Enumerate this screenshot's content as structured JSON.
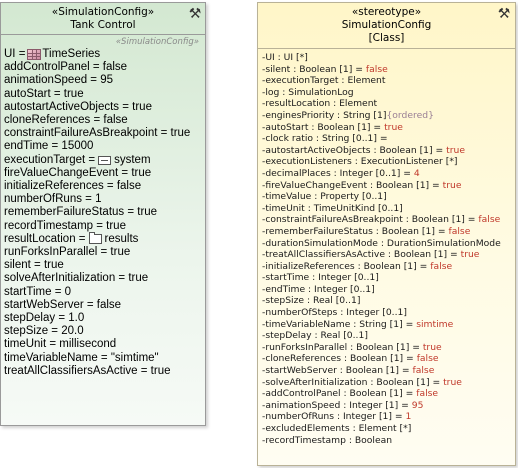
{
  "left": {
    "stereotype": "«SimulationConfig»",
    "title": "Tank Control",
    "applied_stereotype": "«SimulationConfig»",
    "rows": [
      {
        "name": "UI = ",
        "icon": "table-icon",
        "rest": "TimeSeries"
      },
      {
        "name": "addControlPanel = false"
      },
      {
        "name": "animationSpeed = 95"
      },
      {
        "name": "autoStart = true"
      },
      {
        "name": "autostartActiveObjects = true"
      },
      {
        "name": "cloneReferences = false"
      },
      {
        "name": "constraintFailureAsBreakpoint = true"
      },
      {
        "name": "endTime = 15000"
      },
      {
        "name": "executionTarget = ",
        "icon": "enum-icon",
        "rest": "system"
      },
      {
        "name": "fireValueChangeEvent = true"
      },
      {
        "name": "initializeReferences = false"
      },
      {
        "name": "numberOfRuns = 1"
      },
      {
        "name": "rememberFailureStatus = true"
      },
      {
        "name": "recordTimestamp = true"
      },
      {
        "name": "resultLocation = ",
        "icon": "folder-icon",
        "rest": "results"
      },
      {
        "name": "runForksInParallel = true"
      },
      {
        "name": "silent = true"
      },
      {
        "name": "solveAfterInitialization = true"
      },
      {
        "name": "startTime = 0"
      },
      {
        "name": "startWebServer = false"
      },
      {
        "name": "stepDelay = 1.0"
      },
      {
        "name": "stepSize = 20.0"
      },
      {
        "name": "timeUnit = millisecond"
      },
      {
        "name": "timeVariableName = \"simtime\""
      },
      {
        "name": "treatAllClassifiersAsActive = true"
      }
    ]
  },
  "right": {
    "stereotype": "«stereotype»",
    "title": "SimulationConfig",
    "kind": "[Class]",
    "rows": [
      {
        "text": "-UI : UI [*]"
      },
      {
        "text": "-silent : Boolean [1] = ",
        "val": "false"
      },
      {
        "text": "-executionTarget : Element"
      },
      {
        "text": "-log : SimulationLog"
      },
      {
        "text": "-resultLocation : Element"
      },
      {
        "text": "-enginesPriority : String [1]",
        "mod": "{ordered}"
      },
      {
        "text": "-autoStart : Boolean [1] = ",
        "val": "true"
      },
      {
        "text": "-clock ratio : String [0..1] ="
      },
      {
        "text": "-autostartActiveObjects : Boolean [1] = ",
        "val": "true"
      },
      {
        "text": "-executionListeners : ExecutionListener [*]"
      },
      {
        "text": "-decimalPlaces : Integer [0..1] = ",
        "val": "4"
      },
      {
        "text": "-fireValueChangeEvent : Boolean [1] = ",
        "val": "true"
      },
      {
        "text": "-timeValue : Property [0..1]"
      },
      {
        "text": "-timeUnit : TimeUnitKind [0..1]"
      },
      {
        "text": "-constraintFailureAsBreakpoint : Boolean [1] = ",
        "val": "false"
      },
      {
        "text": "-rememberFailureStatus : Boolean [1] = ",
        "val": "false"
      },
      {
        "text": "-durationSimulationMode : DurationSimulationMode"
      },
      {
        "text": "-treatAllClassifiersAsActive : Boolean [1] = ",
        "val": "true"
      },
      {
        "text": "-initializeReferences : Boolean [1] = ",
        "val": "false"
      },
      {
        "text": "-startTime : Integer [0..1]"
      },
      {
        "text": "-endTime : Integer [0..1]"
      },
      {
        "text": "-stepSize : Real [0..1]"
      },
      {
        "text": "-numberOfSteps : Integer [0..1]"
      },
      {
        "text": "-timeVariableName : String [1] = ",
        "val": "simtime"
      },
      {
        "text": "-stepDelay : Real [0..1]"
      },
      {
        "text": "-runForksInParallel : Boolean [1] = ",
        "val": "true"
      },
      {
        "text": "-cloneReferences : Boolean [1] = ",
        "val": "false"
      },
      {
        "text": "-startWebServer : Boolean [1] = ",
        "val": "false"
      },
      {
        "text": "-solveAfterInitialization : Boolean [1] = ",
        "val": "true"
      },
      {
        "text": "-addControlPanel : Boolean [1] = ",
        "val": "false"
      },
      {
        "text": "-animationSpeed : Integer [1] = ",
        "val": "95"
      },
      {
        "text": "-numberOfRuns : Integer [1] = ",
        "val": "1"
      },
      {
        "text": "-excludedElements : Element [*]"
      },
      {
        "text": "-recordTimestamp : Boolean"
      }
    ]
  },
  "icons": {
    "wrench": "wrench-icon",
    "table": "table-icon",
    "enum": "enum-icon",
    "folder": "folder-icon"
  },
  "colors": {
    "left_fill": "#d3e8d1",
    "right_fill": "#fff6c8",
    "default_value": "#c0392b",
    "modifier": "#9a7f95"
  }
}
